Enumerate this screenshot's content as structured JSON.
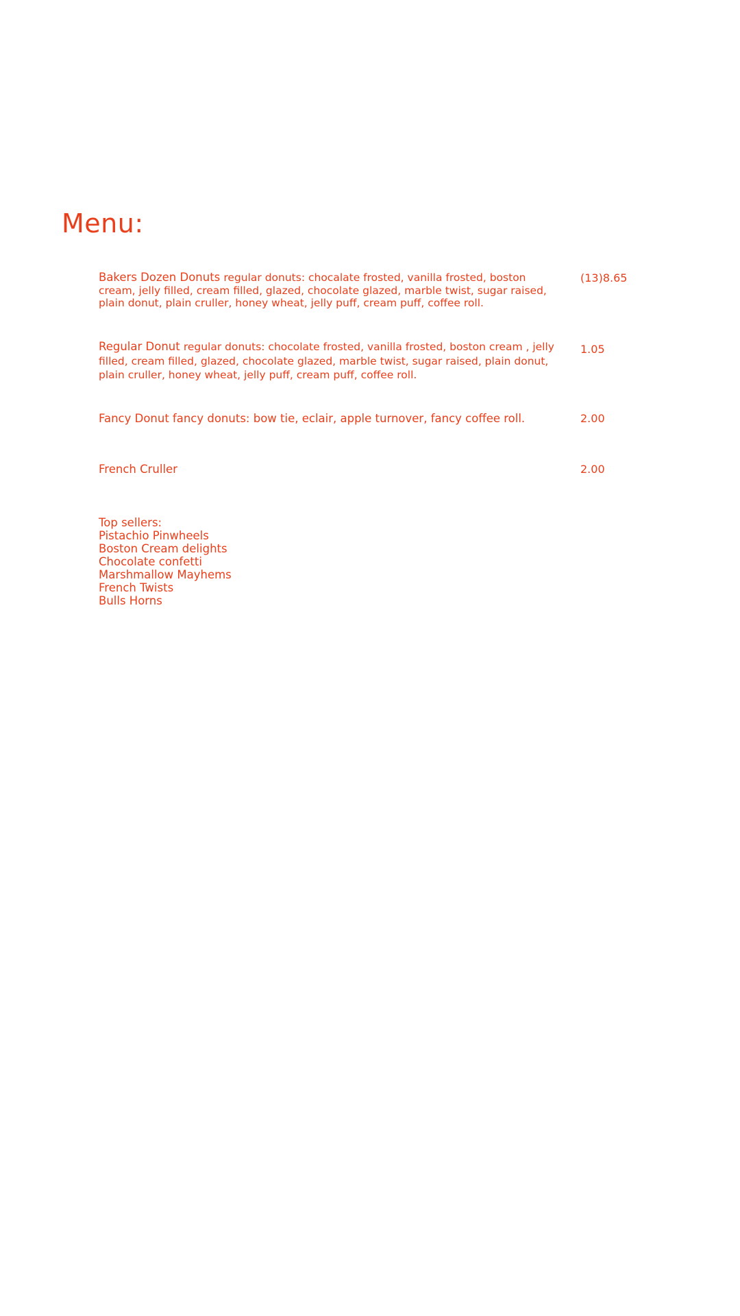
{
  "menu": {
    "title": "Menu:",
    "items": [
      {
        "name": "Bakers Dozen Donuts",
        "description": "regular donuts: chocalate frosted, vanilla frosted, boston cream, jelly filled, cream filled, glazed, chocolate glazed, marble twist, sugar raised, plain donut, plain cruller, honey wheat, jelly puff, cream puff, coffee roll.",
        "price": "(13)8.65"
      },
      {
        "name": "Regular Donut",
        "description": "regular donuts: chocolate frosted, vanilla frosted, boston cream , jelly filled, cream filled, glazed, chocolate glazed, marble twist, sugar raised, plain donut, plain cruller, honey wheat, jelly puff, cream puff, coffee roll.",
        "price": "1.05"
      },
      {
        "name": "Fancy Donut",
        "description": "fancy donuts: bow tie, eclair, apple turnover, fancy coffee roll.",
        "price": "2.00"
      },
      {
        "name": "French Cruller",
        "description": "",
        "price": "2.00"
      }
    ]
  },
  "top_sellers": {
    "heading": "Top sellers:",
    "items": [
      "Pistachio Pinwheels",
      "Boston Cream delights",
      "Chocolate confetti",
      "Marshmallow Mayhems",
      "French Twists",
      "Bulls Horns"
    ]
  },
  "colors": {
    "text": "#e8401c",
    "background": "#ffffff"
  }
}
